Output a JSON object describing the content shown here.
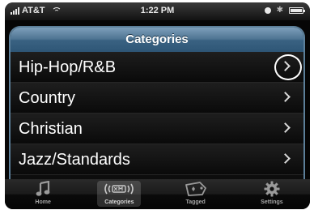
{
  "status_bar": {
    "carrier": "AT&T",
    "time": "1:22 PM"
  },
  "header": {
    "title": "Categories"
  },
  "categories": [
    {
      "label": "Hip-Hop/R&B"
    },
    {
      "label": "Country"
    },
    {
      "label": "Christian"
    },
    {
      "label": "Jazz/Standards"
    }
  ],
  "tab_bar": {
    "tabs": [
      {
        "label": "Home",
        "icon": "music-note-icon",
        "selected": false
      },
      {
        "label": "Categories",
        "icon": "xm-logo-icon",
        "selected": true
      },
      {
        "label": "Tagged",
        "icon": "tag-icon",
        "selected": false
      },
      {
        "label": "Settings",
        "icon": "gear-icon",
        "selected": false
      }
    ]
  },
  "colors": {
    "header_blue": "#4d7391",
    "panel_border": "#5c7f99",
    "background": "#0b0b0b"
  }
}
